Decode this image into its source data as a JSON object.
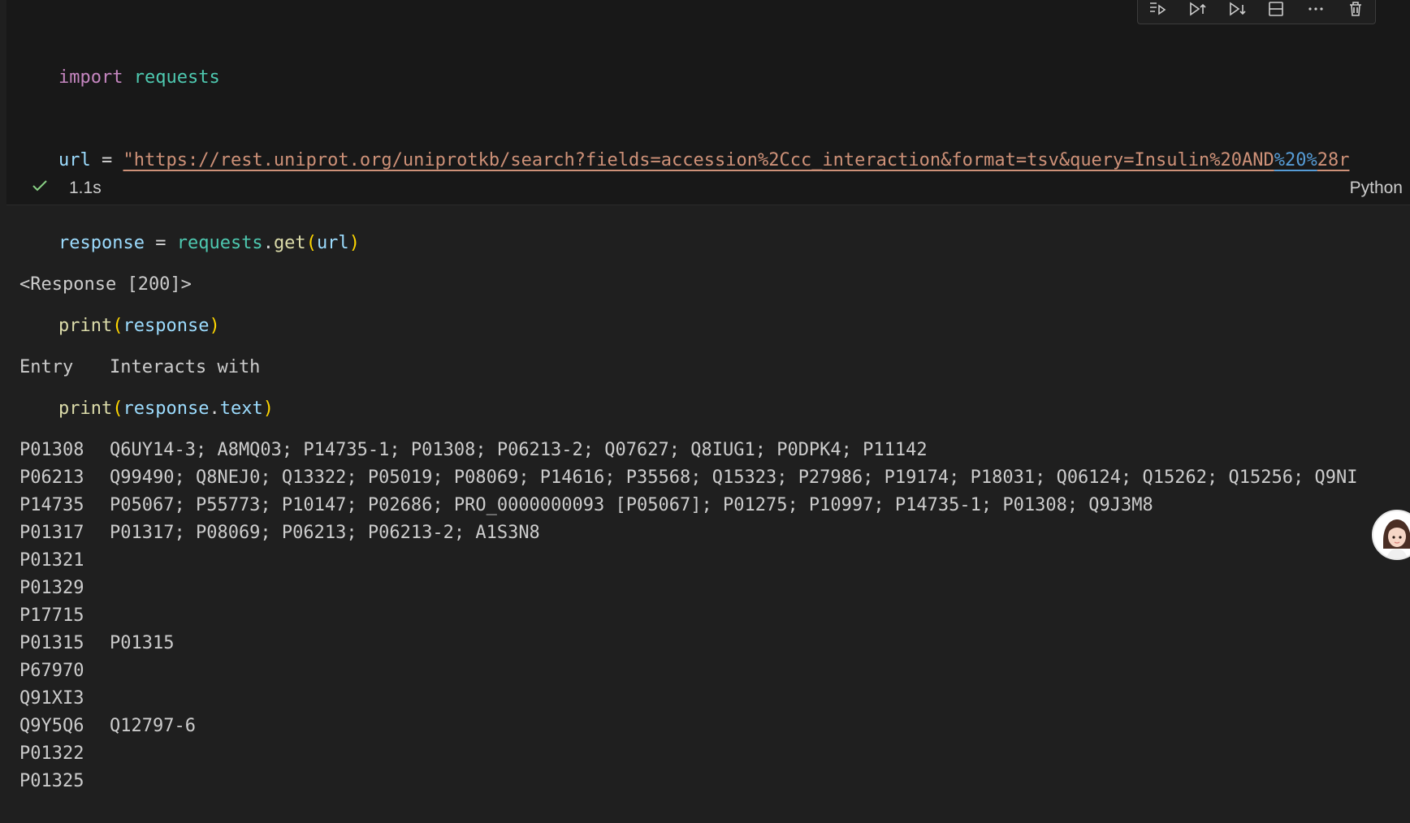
{
  "code": {
    "kw_import": "import",
    "mod_requests": "requests",
    "var_url": "url",
    "op_assign": " = ",
    "url_before": "\"https://rest.uniprot.org/uniprotkb/search?fields=accession%2Ccc_interaction&format=tsv&query=Insulin%20AND",
    "url_highlight": "%20%",
    "url_after": "28r",
    "var_response": "response",
    "fn_get": "get",
    "fn_print": "print",
    "attr_text": "text"
  },
  "status": {
    "duration": "1.1s",
    "language": "Python"
  },
  "output": {
    "response_line": "<Response [200]>",
    "header_entry": "Entry",
    "header_interacts": "Interacts with",
    "rows": [
      {
        "entry": "P01308",
        "interacts": "Q6UY14-3; A8MQ03; P14735-1; P01308; P06213-2; Q07627; Q8IUG1; P0DPK4; P11142"
      },
      {
        "entry": "P06213",
        "interacts": "Q99490; Q8NEJ0; Q13322; P05019; P08069; P14616; P35568; Q15323; P27986; P19174; P18031; Q06124; Q15262; Q15256; Q9NI"
      },
      {
        "entry": "P14735",
        "interacts": "P05067; P55773; P10147; P02686; PRO_0000000093 [P05067]; P01275; P10997; P14735-1; P01308; Q9J3M8"
      },
      {
        "entry": "P01317",
        "interacts": "P01317; P08069; P06213; P06213-2; A1S3N8"
      },
      {
        "entry": "P01321",
        "interacts": ""
      },
      {
        "entry": "P01329",
        "interacts": ""
      },
      {
        "entry": "P17715",
        "interacts": ""
      },
      {
        "entry": "P01315",
        "interacts": "P01315"
      },
      {
        "entry": "P67970",
        "interacts": ""
      },
      {
        "entry": "Q91XI3",
        "interacts": ""
      },
      {
        "entry": "Q9Y5Q6",
        "interacts": "Q12797-6"
      },
      {
        "entry": "P01322",
        "interacts": ""
      },
      {
        "entry": "P01325",
        "interacts": ""
      }
    ]
  },
  "toolbar": {
    "icons": [
      "run-by-line-icon",
      "execute-above-icon",
      "execute-below-icon",
      "split-cell-icon",
      "more-actions-icon",
      "delete-cell-icon"
    ]
  },
  "colors": {
    "background": "#1f1f1f",
    "cell_background": "#181818",
    "keyword": "#c586c0",
    "module": "#4ec9b0",
    "variable": "#9cdcfe",
    "function": "#dcdcaa",
    "string": "#ce9178",
    "success_check": "#89d185"
  }
}
